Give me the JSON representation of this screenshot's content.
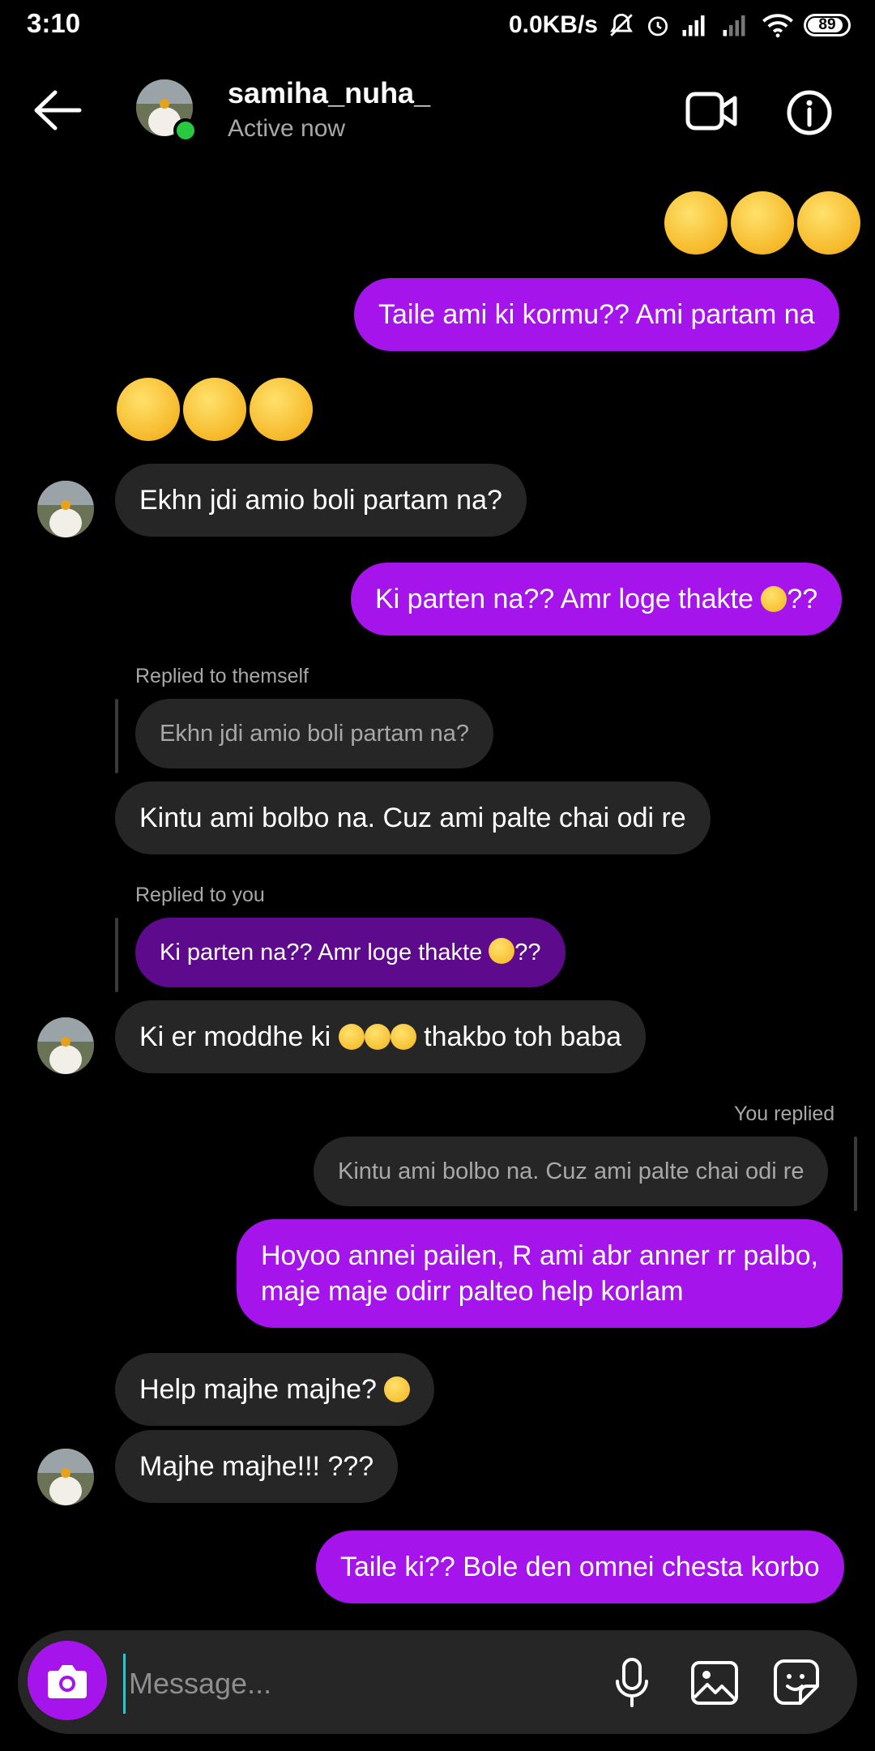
{
  "status_bar": {
    "time": "3:10",
    "net_speed": "0.0KB/s",
    "battery": "89"
  },
  "header": {
    "username": "samiha_nuha_",
    "status": "Active now"
  },
  "messages": {
    "m1_reply": "Taile ami ki kormu?? Ami partam na",
    "m2_text": "Ekhn jdi amio boli partam na?",
    "m3_text": "Ki parten na?? Amr loge thakte",
    "m3_suffix": "??",
    "r1_label": "Replied to themself",
    "r1_quote": "Ekhn jdi amio boli partam na?",
    "r1_text": "Kintu ami bolbo na. Cuz ami palte chai odi re",
    "r2_label": "Replied to you",
    "r2_quote": "Ki parten na?? Amr loge thakte",
    "r2_quote_suffix": "??",
    "r2_text_prefix": "Ki er moddhe ki",
    "r2_text_suffix": "thakbo toh baba",
    "r3_label": "You replied",
    "r3_quote": "Kintu ami bolbo na. Cuz ami palte chai odi re",
    "r3_text_line1": "Hoyoo annei pailen, R ami abr anner rr palbo,",
    "r3_text_line2": "maje maje odirr palteo help korlam",
    "m4_text": "Help majhe majhe?",
    "m5_text": "Majhe majhe!!! ???",
    "m6_text": "Taile ki?? Bole den omnei chesta korbo"
  },
  "composer": {
    "placeholder": "Message..."
  },
  "colors": {
    "sent_bubble": "#a414eb",
    "received_bubble": "#262626",
    "online": "#27c93f",
    "background": "#000000"
  },
  "icons": [
    "back-arrow-icon",
    "video-call-icon",
    "info-icon",
    "camera-icon",
    "microphone-icon",
    "gallery-icon",
    "sticker-icon"
  ]
}
